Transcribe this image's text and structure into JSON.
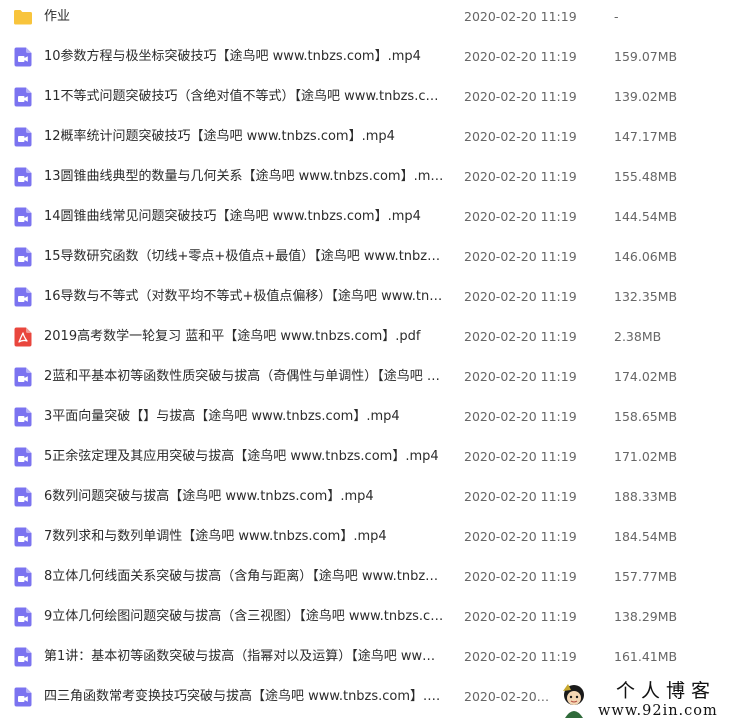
{
  "files": [
    {
      "type": "folder",
      "name": "作业",
      "date": "2020-02-20 11:19",
      "size": "-"
    },
    {
      "type": "video",
      "name": "10参数方程与极坐标突破技巧【途鸟吧 www.tnbzs.com】.mp4",
      "date": "2020-02-20 11:19",
      "size": "159.07MB"
    },
    {
      "type": "video",
      "name": "11不等式问题突破技巧（含绝对值不等式）【途鸟吧 www.tnbzs.com】...",
      "date": "2020-02-20 11:19",
      "size": "139.02MB"
    },
    {
      "type": "video",
      "name": "12概率统计问题突破技巧【途鸟吧 www.tnbzs.com】.mp4",
      "date": "2020-02-20 11:19",
      "size": "147.17MB"
    },
    {
      "type": "video",
      "name": "13圆锥曲线典型的数量与几何关系【途鸟吧 www.tnbzs.com】.mp4",
      "date": "2020-02-20 11:19",
      "size": "155.48MB"
    },
    {
      "type": "video",
      "name": "14圆锥曲线常见问题突破技巧【途鸟吧 www.tnbzs.com】.mp4",
      "date": "2020-02-20 11:19",
      "size": "144.54MB"
    },
    {
      "type": "video",
      "name": "15导数研究函数（切线+零点+极值点+最值）【途鸟吧 www.tnbzs.com...",
      "date": "2020-02-20 11:19",
      "size": "146.06MB"
    },
    {
      "type": "video",
      "name": "16导数与不等式（对数平均不等式+极值点偏移）【途鸟吧 www.tnbzs.c...",
      "date": "2020-02-20 11:19",
      "size": "132.35MB"
    },
    {
      "type": "pdf",
      "name": "2019高考数学一轮复习 蓝和平【途鸟吧 www.tnbzs.com】.pdf",
      "date": "2020-02-20 11:19",
      "size": "2.38MB"
    },
    {
      "type": "video",
      "name": "2蓝和平基本初等函数性质突破与拔高（奇偶性与单调性）【途鸟吧 www....",
      "date": "2020-02-20 11:19",
      "size": "174.02MB"
    },
    {
      "type": "video",
      "name": "3平面向量突破【】与拔高【途鸟吧 www.tnbzs.com】.mp4",
      "date": "2020-02-20 11:19",
      "size": "158.65MB"
    },
    {
      "type": "video",
      "name": "5正余弦定理及其应用突破与拔高【途鸟吧 www.tnbzs.com】.mp4",
      "date": "2020-02-20 11:19",
      "size": "171.02MB"
    },
    {
      "type": "video",
      "name": "6数列问题突破与拔高【途鸟吧 www.tnbzs.com】.mp4",
      "date": "2020-02-20 11:19",
      "size": "188.33MB"
    },
    {
      "type": "video",
      "name": "7数列求和与数列单调性【途鸟吧 www.tnbzs.com】.mp4",
      "date": "2020-02-20 11:19",
      "size": "184.54MB"
    },
    {
      "type": "video",
      "name": "8立体几何线面关系突破与拔高（含角与距离）【途鸟吧 www.tnbzs.com...",
      "date": "2020-02-20 11:19",
      "size": "157.77MB"
    },
    {
      "type": "video",
      "name": "9立体几何绘图问题突破与拔高（含三视图）【途鸟吧 www.tnbzs.com】...",
      "date": "2020-02-20 11:19",
      "size": "138.29MB"
    },
    {
      "type": "video",
      "name": "第1讲：基本初等函数突破与拔高（指幂对以及运算）【途鸟吧 www.tnbz...",
      "date": "2020-02-20 11:19",
      "size": "161.41MB"
    },
    {
      "type": "video",
      "name": "四三角函数常考变换技巧突破与拔高【途鸟吧 www.tnbzs.com】.mp4",
      "date": "2020-02-20 11:19",
      "size": ""
    }
  ],
  "watermark": {
    "title": "个人博客",
    "url": "www.92in.com"
  },
  "colors": {
    "folder": "#f8c43c",
    "video": "#7b73f0",
    "pdf": "#e9463d"
  }
}
